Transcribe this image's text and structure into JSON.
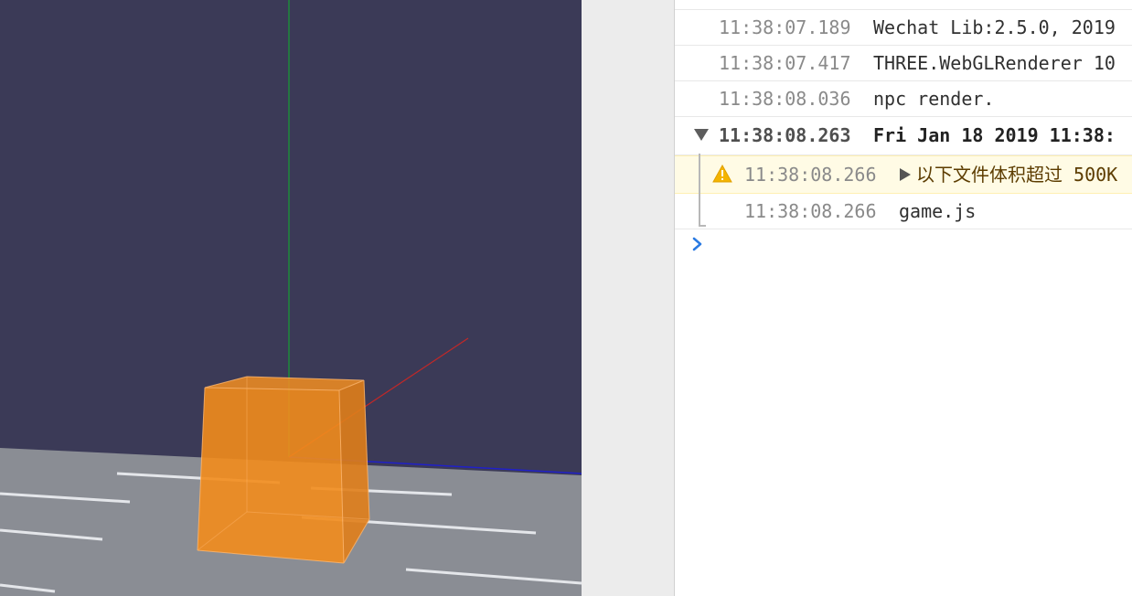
{
  "viewport": {
    "label": "3D scene viewport",
    "colors": {
      "sky": "#3b3a57",
      "ground": "#8a8d94",
      "cube": "#f28c1c",
      "y_axis": "#1e8a3c",
      "x_axis": "#2020c8",
      "z_axis": "#c02828"
    }
  },
  "console": {
    "entries": [
      {
        "time": "11:38:07.189",
        "text": "Wechat Lib:2.5.0, 2019"
      },
      {
        "time": "11:38:07.417",
        "text": "THREE.WebGLRenderer 10"
      },
      {
        "time": "11:38:08.036",
        "text": "npc render."
      }
    ],
    "group": {
      "time": "11:38:08.263",
      "text": "Fri Jan 18 2019 11:38:"
    },
    "warning": {
      "time": "11:38:08.266",
      "text": "以下文件体积超过 500K",
      "icon": "warning-icon"
    },
    "child": {
      "time": "11:38:08.266",
      "text": "game.js"
    },
    "prompt_icon": "chevron-right-icon"
  }
}
